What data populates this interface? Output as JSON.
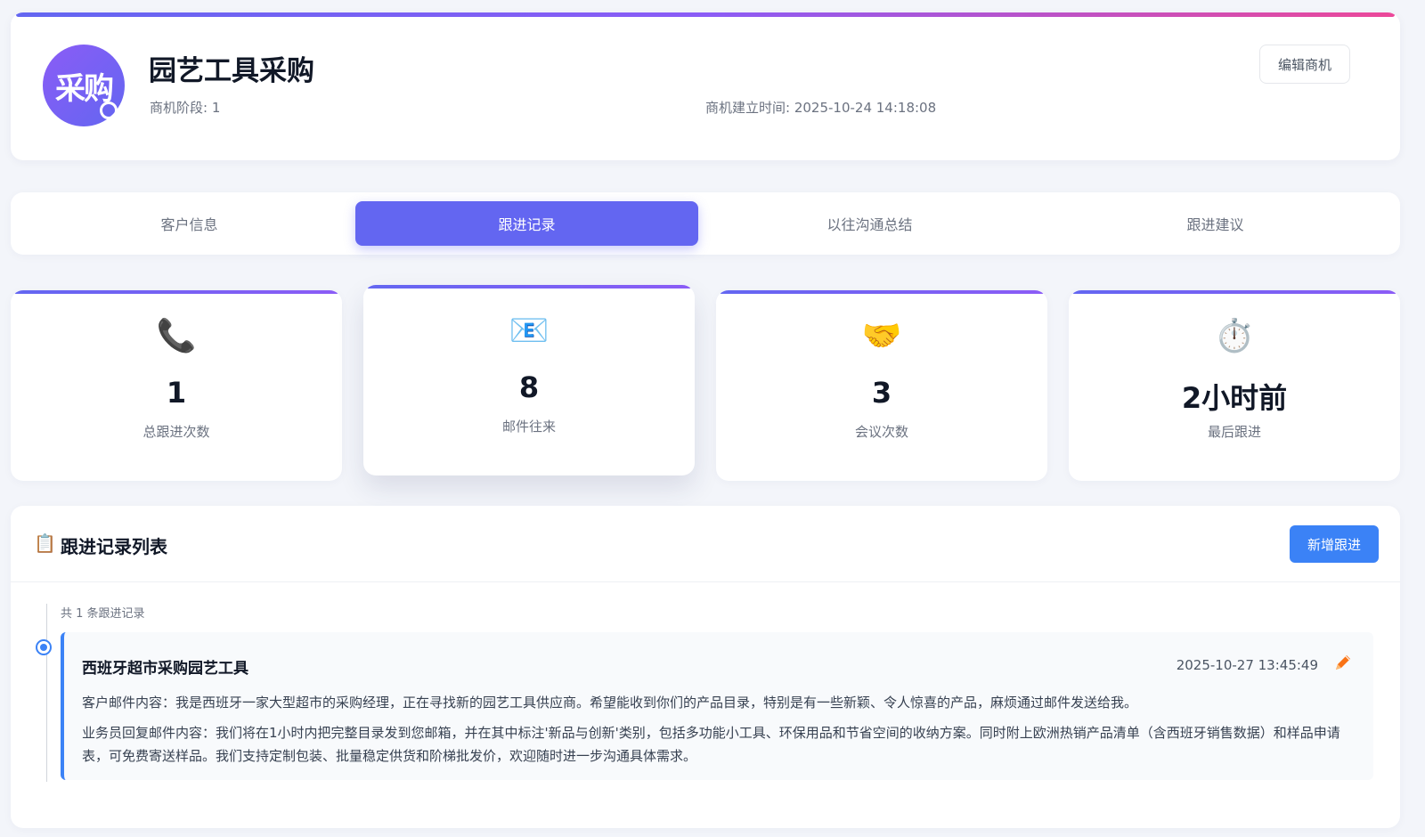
{
  "header": {
    "avatar_text": "采购",
    "title": "园艺工具采购",
    "stage": "商机阶段: 1",
    "created": "商机建立时间: 2025-10-24 14:18:08",
    "edit_label": "编辑商机"
  },
  "tabs": [
    {
      "label": "客户信息",
      "active": false
    },
    {
      "label": "跟进记录",
      "active": true
    },
    {
      "label": "以往沟通总结",
      "active": false
    },
    {
      "label": "跟进建议",
      "active": false
    }
  ],
  "stats": [
    {
      "icon": "📞",
      "icon_name": "phone-icon",
      "value": "1",
      "label": "总跟进次数"
    },
    {
      "icon": "📧",
      "icon_name": "email-icon",
      "value": "8",
      "label": "邮件往来"
    },
    {
      "icon": "🤝",
      "icon_name": "handshake-icon",
      "value": "3",
      "label": "会议次数"
    },
    {
      "icon": "⏱️",
      "icon_name": "stopwatch-icon",
      "value": "2小时前",
      "label": "最后跟进"
    }
  ],
  "records_panel": {
    "icon": "📋",
    "title": "跟进记录列表",
    "add_label": "新增跟进",
    "count_text": "共 1 条跟进记录",
    "records": [
      {
        "title": "西班牙超市采购园艺工具",
        "time": "2025-10-27 13:45:49",
        "customer_text": "客户邮件内容：我是西班牙一家大型超市的采购经理，正在寻找新的园艺工具供应商。希望能收到你们的产品目录，特别是有一些新颖、令人惊喜的产品，麻烦通过邮件发送给我。",
        "reply_text": "业务员回复邮件内容：我们将在1小时内把完整目录发到您邮箱，并在其中标注'新品与创新'类别，包括多功能小工具、环保用品和节省空间的收纳方案。同时附上欧洲热销产品清单（含西班牙销售数据）和样品申请表，可免费寄送样品。我们支持定制包装、批量稳定供货和阶梯批发价，欢迎随时进一步沟通具体需求。"
      }
    ]
  },
  "colors": {
    "accent": "#6366f1",
    "primary_button": "#3b82f6",
    "gradient_end": "#ec4899"
  }
}
